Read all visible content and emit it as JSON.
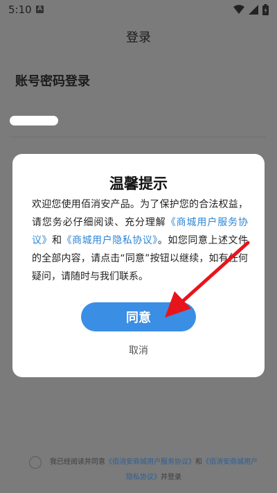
{
  "status_bar": {
    "time": "5:10",
    "badge": "A",
    "icons": [
      "wifi-icon",
      "signal-icon",
      "battery-charging-icon"
    ]
  },
  "header": {
    "title": "登录"
  },
  "login": {
    "section_title": "账号密码登录"
  },
  "dialog": {
    "title": "温馨提示",
    "body_1": "欢迎您使用佰消安产品。为了保护您的合法权益，请您务必仔细阅读、充分理解",
    "link_service": "《商城用户服务协议》",
    "and": "和",
    "link_privacy": "《商城用户隐私协议》",
    "body_2": "。如您同意上述文件的全部内容，请点击“同意”按钮以继续，如有任何疑问，请随时与我们联系。",
    "agree_label": "同意",
    "cancel_label": "取消"
  },
  "footer": {
    "prefix": "我已经阅读并同意",
    "link_service": "《佰消安商城用户服务协议》",
    "and": "和",
    "link_privacy": "《佰消安商城用户隐私协议》",
    "suffix": "并登录"
  },
  "colors": {
    "accent": "#3a8ee4",
    "link": "#2b86d6",
    "annotation": "#e8141b"
  }
}
